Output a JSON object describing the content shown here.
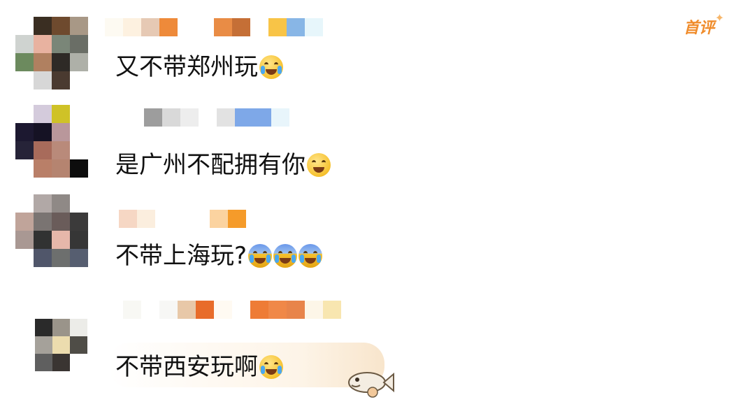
{
  "badge": {
    "label": "首评"
  },
  "comments": [
    {
      "avatar_colors": [
        "#ffffff",
        "#3a2e22",
        "#6e4a2e",
        "#a89886",
        "#cfd3d0",
        "#e8b2a0",
        "#7a8678",
        "#6a6e66",
        "#6c8a5e",
        "#b08060",
        "#2e2a26",
        "#aeb0a8",
        "#ffffff",
        "#d7d7d7",
        "#4a3a30",
        "#ffffff"
      ],
      "name_colors": [
        "#fdfaf2",
        "#fdf1e0",
        "#e6c9b4",
        "#ee8a3a",
        "#ffffff",
        "#ffffff",
        "#e98c45",
        "#c56f36",
        "#ffffff",
        "#f8c447",
        "#88b6e6",
        "#e7f6fb"
      ],
      "text": "又不带郑州玩",
      "emoji": [
        "laugh-cry-emoji"
      ]
    },
    {
      "avatar_colors": [
        "#ffffff",
        "#d4cbdc",
        "#cfc227",
        "#ffffff",
        "#1c1830",
        "#151224",
        "#b9979b",
        "#ffffff",
        "#262338",
        "#a86b5b",
        "#b98a7a",
        "#ffffff",
        "#ffffff",
        "#b97f68",
        "#b58470",
        "#0d0d0d"
      ],
      "name_colors": [
        "#ffffff",
        "#9d9d9d",
        "#d9d9d9",
        "#ededed",
        "#ffffff",
        "#e2e2e2",
        "#7ea8e8",
        "#7ea8e8",
        "#e8f5fb"
      ],
      "text": "是广州不配拥有你",
      "emoji": [
        "sweat-smile-emoji"
      ]
    },
    {
      "avatar_colors": [
        "#ffffff",
        "#b1a8a6",
        "#8f8986",
        "#ffffff",
        "#c0a49a",
        "#7a7472",
        "#6a5c5a",
        "#3b3a3a",
        "#a99893",
        "#313232",
        "#e6b7aa",
        "#363636",
        "#ffffff",
        "#50566a",
        "#6d6f6e",
        "#565e70"
      ],
      "name_colors": [
        "#f6d7c4",
        "#fbeede",
        "#ffffff",
        "#ffffff",
        "#ffffff",
        "#fbd3a0",
        "#f59b2a"
      ],
      "text": "不带上海玩?",
      "emoji": [
        "crying-emoji",
        "crying-emoji",
        "crying-emoji"
      ]
    },
    {
      "avatar_colors": [
        "#2a2a2a",
        "#9a948a",
        "#ecece8",
        "#a5a19a",
        "#ecdcae",
        "#4f4d47",
        "#5f5f5f",
        "#3a3532",
        "#ffffff"
      ],
      "name_colors": [
        "#ffffff",
        "#f8f8f4",
        "#ffffff",
        "#f7f7f5",
        "#e8c8a8",
        "#e86c2a",
        "#fffaf2",
        "#ffffff",
        "#ee7c36",
        "#f08848",
        "#e8844a",
        "#fdf6e8",
        "#f8e6b0"
      ],
      "text": "不带西安玩啊",
      "emoji": [
        "sobbing-emoji"
      ]
    }
  ]
}
